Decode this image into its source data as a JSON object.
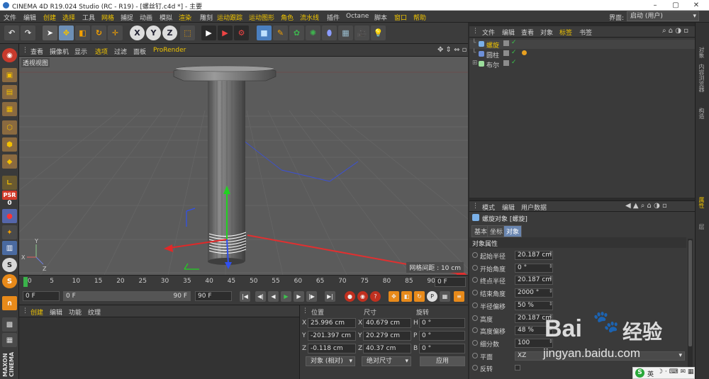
{
  "window": {
    "title": "CINEMA 4D R19.024 Studio (RC - R19) - [螺丝钉.c4d *] - 主要",
    "min": "–",
    "max": "▢",
    "close": "✕"
  },
  "menubar": {
    "items": [
      {
        "label": "文件",
        "highlight": false
      },
      {
        "label": "编辑",
        "highlight": false
      },
      {
        "label": "创建",
        "highlight": true
      },
      {
        "label": "选择",
        "highlight": true
      },
      {
        "label": "工具",
        "highlight": false
      },
      {
        "label": "网格",
        "highlight": true
      },
      {
        "label": "捕捉",
        "highlight": false
      },
      {
        "label": "动画",
        "highlight": false
      },
      {
        "label": "模拟",
        "highlight": false
      },
      {
        "label": "渲染",
        "highlight": true
      },
      {
        "label": "雕刻",
        "highlight": false
      },
      {
        "label": "运动跟踪",
        "highlight": true
      },
      {
        "label": "运动图形",
        "highlight": true
      },
      {
        "label": "角色",
        "highlight": true
      },
      {
        "label": "流水线",
        "highlight": true
      },
      {
        "label": "插件",
        "highlight": false
      },
      {
        "label": "Octane",
        "highlight": false
      },
      {
        "label": "脚本",
        "highlight": false
      },
      {
        "label": "窗口",
        "highlight": true
      },
      {
        "label": "帮助",
        "highlight": true
      }
    ],
    "layout_label": "界面:",
    "layout_value": "启动 (用户)"
  },
  "toolbar": {
    "axis_x": "X",
    "axis_y": "Y",
    "axis_z": "Z"
  },
  "left_palette": {
    "psr_label": "PSR",
    "psr_value": "0",
    "maxon_label": "MAXON CINEMA"
  },
  "viewport": {
    "menu": [
      "查看",
      "摄像机",
      "显示",
      "选项",
      "过滤",
      "面板",
      "ProRender"
    ],
    "name": "透视视图",
    "grid_info": "网格间距 : 10 cm"
  },
  "timeline": {
    "ticks": [
      "0",
      "5",
      "10",
      "15",
      "20",
      "25",
      "30",
      "35",
      "40",
      "45",
      "50",
      "55",
      "60",
      "65",
      "70",
      "75",
      "80",
      "85",
      "90"
    ],
    "current_frame": "0 F",
    "start_frame": "0 F",
    "range_start": "0 F",
    "range_end": "90 F",
    "end_frame": "90 F"
  },
  "materials": {
    "menu": [
      "创建",
      "编辑",
      "功能",
      "纹理"
    ]
  },
  "coordinates": {
    "headers": {
      "position": "位置",
      "size": "尺寸",
      "rotation": "旋转"
    },
    "rows": [
      {
        "axis": "X",
        "pos": "25.996 cm",
        "size_axis": "X",
        "size": "40.679 cm",
        "rot_axis": "H",
        "rot": "0 °"
      },
      {
        "axis": "Y",
        "pos": "-201.397 cm",
        "size_axis": "Y",
        "size": "20.279 cm",
        "rot_axis": "P",
        "rot": "0 °"
      },
      {
        "axis": "Z",
        "pos": "-0.118 cm",
        "size_axis": "Z",
        "size": "40.37 cm",
        "rot_axis": "B",
        "rot": "0 °"
      }
    ],
    "mode": "对象 (相对)",
    "size_mode": "绝对尺寸",
    "apply": "应用"
  },
  "object_manager": {
    "menu": [
      "文件",
      "编辑",
      "查看",
      "对象",
      "标签",
      "书签"
    ],
    "objects": [
      {
        "name": "螺旋",
        "color": "#f0c400"
      },
      {
        "name": "圆柱",
        "color": "#d0d0d0"
      },
      {
        "name": "布尔",
        "color": "#d0d0d0"
      }
    ]
  },
  "attribute_manager": {
    "menu": [
      "模式",
      "编辑",
      "用户数据"
    ],
    "object_title": "螺旋对象 [螺旋]",
    "tabs": [
      "基本",
      "坐标",
      "对象"
    ],
    "section": "对象属性",
    "fields": [
      {
        "label": "起始半径",
        "value": "20.187 cm"
      },
      {
        "label": "开始角度",
        "value": "0 °"
      },
      {
        "label": "终点半径",
        "value": "20.187 cm"
      },
      {
        "label": "结束角度",
        "value": "2000 °"
      },
      {
        "label": "半径偏移",
        "value": "50 %"
      },
      {
        "label": "高度",
        "value": "20.187 cm"
      },
      {
        "label": "高度偏移",
        "value": "48 %"
      },
      {
        "label": "细分数",
        "value": "100"
      },
      {
        "label": "平面",
        "value": "XZ"
      },
      {
        "label": "反转",
        "value": ""
      }
    ]
  },
  "right_tabs": [
    "对象",
    "内容浏览器",
    "构造",
    "属性",
    "层"
  ],
  "watermark": {
    "brand": "Bai",
    "brand2": "经验",
    "url": "jingyan.baidu.com"
  },
  "ime": {
    "label": "英"
  },
  "colors": {
    "accent": "#f0c400",
    "annotation_arrow": "#e03030"
  }
}
